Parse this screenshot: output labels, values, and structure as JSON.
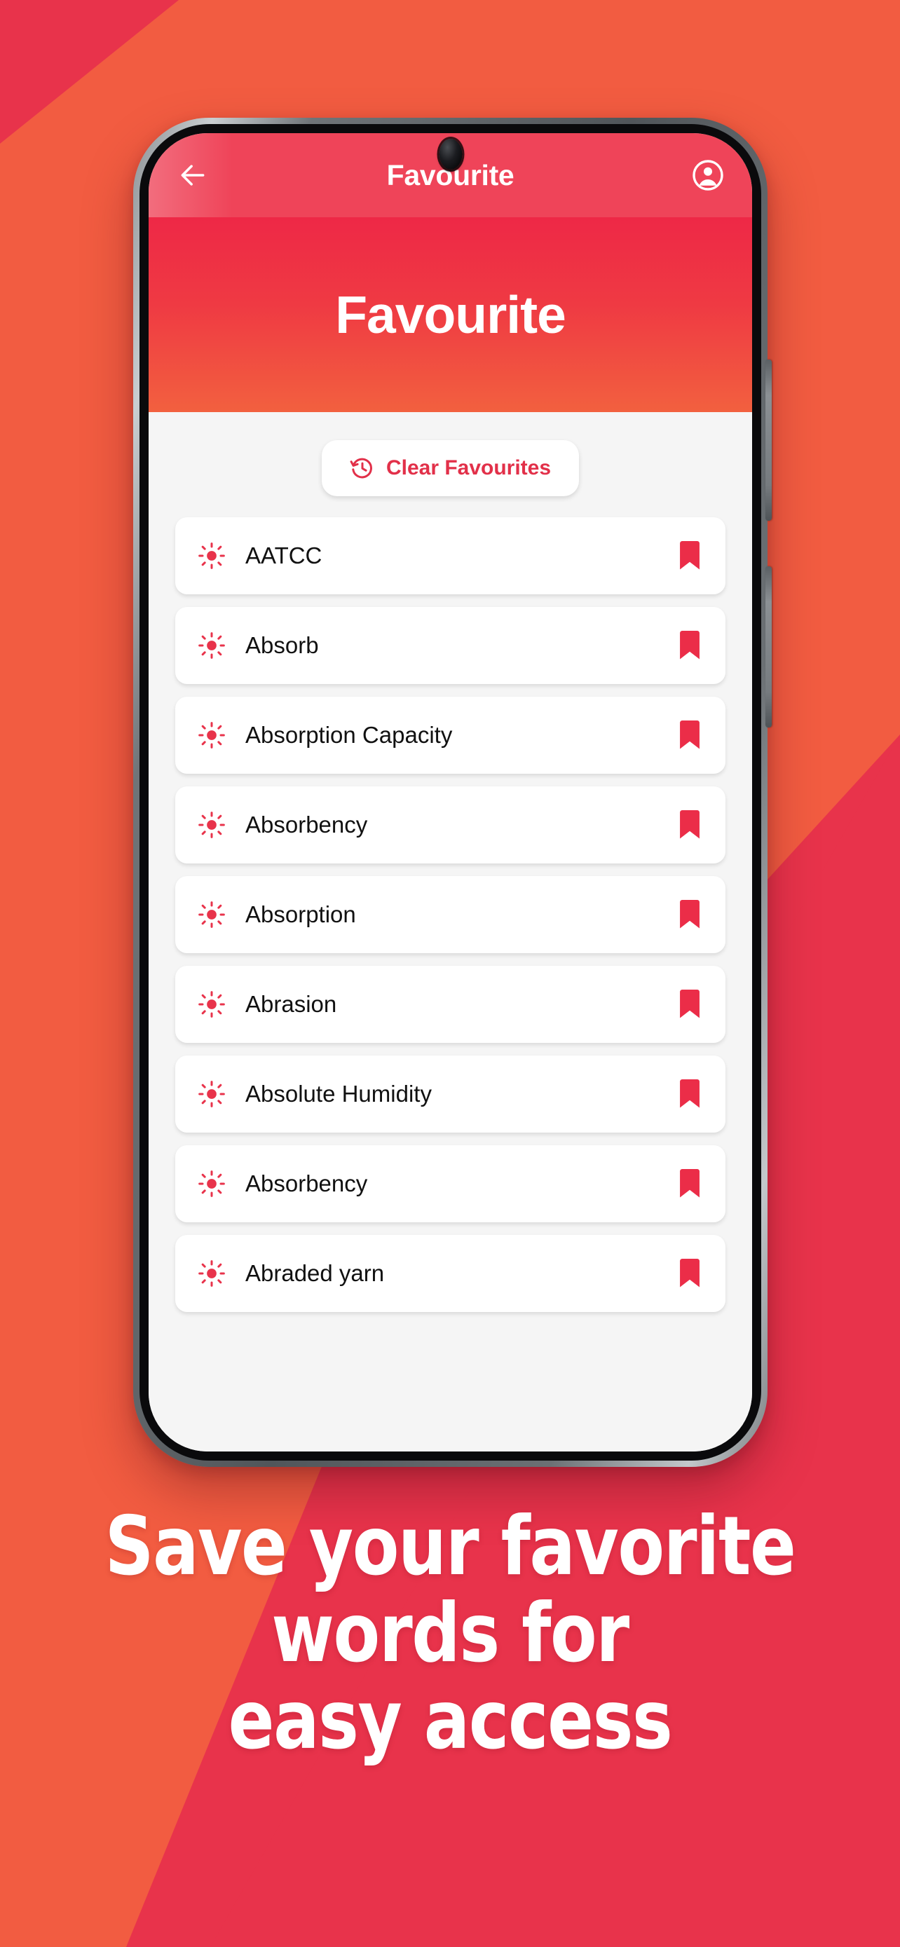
{
  "background": {
    "red": "#E8334B",
    "orange": "#F25C41",
    "accent_red": "#E23049",
    "appbar_red": "#EF4459",
    "hero_gradient_top": "#EE2846",
    "hero_gradient_bottom": "#F2603F"
  },
  "appbar": {
    "back_icon": "arrow-left-icon",
    "title": "Favourite",
    "account_icon": "account-circle-icon"
  },
  "hero": {
    "title": "Favourite"
  },
  "toolbar": {
    "clear_icon": "history-restore-icon",
    "clear_label": "Clear Favourites"
  },
  "list": {
    "items": [
      {
        "word": "AATCC",
        "leading_icon": "sun-icon",
        "trailing_icon": "bookmark-filled-icon"
      },
      {
        "word": "Absorb",
        "leading_icon": "sun-icon",
        "trailing_icon": "bookmark-filled-icon"
      },
      {
        "word": "Absorption Capacity",
        "leading_icon": "sun-icon",
        "trailing_icon": "bookmark-filled-icon"
      },
      {
        "word": "Absorbency",
        "leading_icon": "sun-icon",
        "trailing_icon": "bookmark-filled-icon"
      },
      {
        "word": "Absorption",
        "leading_icon": "sun-icon",
        "trailing_icon": "bookmark-filled-icon"
      },
      {
        "word": "Abrasion",
        "leading_icon": "sun-icon",
        "trailing_icon": "bookmark-filled-icon"
      },
      {
        "word": "Absolute Humidity",
        "leading_icon": "sun-icon",
        "trailing_icon": "bookmark-filled-icon"
      },
      {
        "word": "Absorbency",
        "leading_icon": "sun-icon",
        "trailing_icon": "bookmark-filled-icon"
      },
      {
        "word": "Abraded yarn",
        "leading_icon": "sun-icon",
        "trailing_icon": "bookmark-filled-icon"
      }
    ]
  },
  "caption": {
    "line1": "Save your favorite",
    "line2": "words for",
    "line3": "easy access"
  }
}
